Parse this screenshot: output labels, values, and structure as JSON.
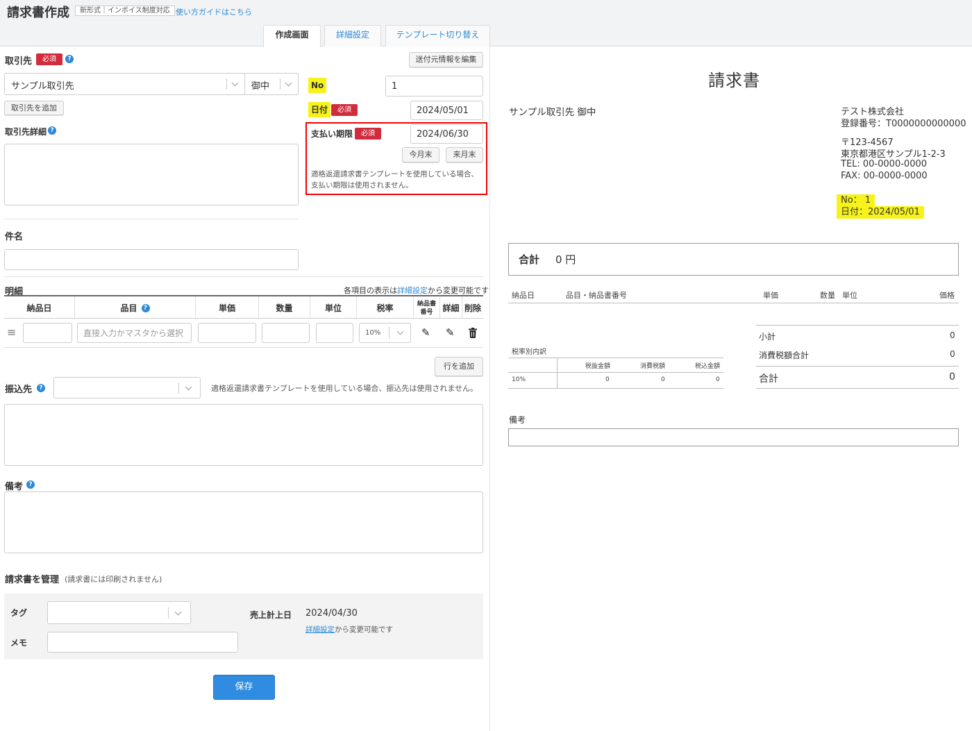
{
  "header": {
    "title": "請求書作成",
    "badge": "新形式｜インボイス制度対応",
    "guide_link": "使い方ガイドはこちら",
    "tabs": [
      "作成画面",
      "詳細設定",
      "テンプレート切り替え"
    ]
  },
  "form": {
    "client_label": "取引先",
    "required": "必須",
    "sender_edit_button": "送付元情報を編集",
    "client_value": "サンプル取引先",
    "honorific_value": "御中",
    "add_client_button": "取引先を追加",
    "no_label": "No",
    "no_value": "1",
    "date_label": "日付",
    "date_value": "2024/05/01",
    "due_label": "支払い期限",
    "due_value": "2024/06/30",
    "this_month_end": "今月末",
    "next_month_end": "来月末",
    "due_note_1": "適格返還請求書テンプレートを使用している場合、",
    "due_note_2": "支払い期限は使用されません。",
    "client_detail_label": "取引先詳細",
    "subject_label": "件名",
    "items_label": "明細",
    "items_note_prefix": "各項目の表示は",
    "items_note_link": "詳細設定",
    "items_note_suffix": "から変更可能です",
    "columns": {
      "delivery_date": "納品日",
      "item": "品目",
      "unit_price": "単価",
      "quantity": "数量",
      "unit": "単位",
      "tax_rate": "税率",
      "delivery_no_1": "納品書",
      "delivery_no_2": "番号",
      "detail": "詳細",
      "delete": "削除"
    },
    "item_placeholder": "直接入力かマスタから選択",
    "tax_value": "10%",
    "add_row_button": "行を追加",
    "bank_label": "振込先",
    "bank_note": "適格返還請求書テンプレートを使用している場合、振込先は使用されません。",
    "remarks_label": "備考",
    "manage_label": "請求書を管理",
    "manage_note": "(請求書には印刷されません)",
    "tag_label": "タグ",
    "memo_label": "メモ",
    "sales_date_label": "売上計上日",
    "sales_date_value": "2024/04/30",
    "sales_note_link": "詳細設定",
    "sales_note_suffix": "から変更可能です",
    "save_button": "保存"
  },
  "preview": {
    "title": "請求書",
    "client": "サンプル取引先 御中",
    "company": "テスト株式会社",
    "reg_no": "登録番号：T0000000000000",
    "postal": "〒123-4567",
    "address": "東京都港区サンプル1-2-3",
    "tel": "TEL: 00-0000-0000",
    "fax": "FAX: 00-0000-0000",
    "no_line": "No：  1",
    "date_line": "日付：2024/05/01",
    "total_label": "合計",
    "total_value": "0 円",
    "col_delivery_date": "納品日",
    "col_item": "品目・納品書番号",
    "col_unit_price": "単価",
    "col_quantity": "数量",
    "col_unit": "単位",
    "col_price": "価格",
    "tax_breakdown_label": "税率別内訳",
    "tax_cols": [
      "税抜金額",
      "消費税額",
      "税込金額"
    ],
    "tax_row": {
      "rate": "10%",
      "excl": "0",
      "tax": "0",
      "incl": "0"
    },
    "subtotal_label": "小計",
    "subtotal_value": "0",
    "tax_total_label": "消費税額合計",
    "tax_total_value": "0",
    "grand_label": "合計",
    "grand_value": "0",
    "remarks_label": "備考"
  },
  "colors": {
    "accent": "#2d89d6",
    "required": "#d12c3c",
    "highlight": "#f7f31a",
    "focus_box": "#ee0000",
    "save": "#2f8ce0"
  }
}
